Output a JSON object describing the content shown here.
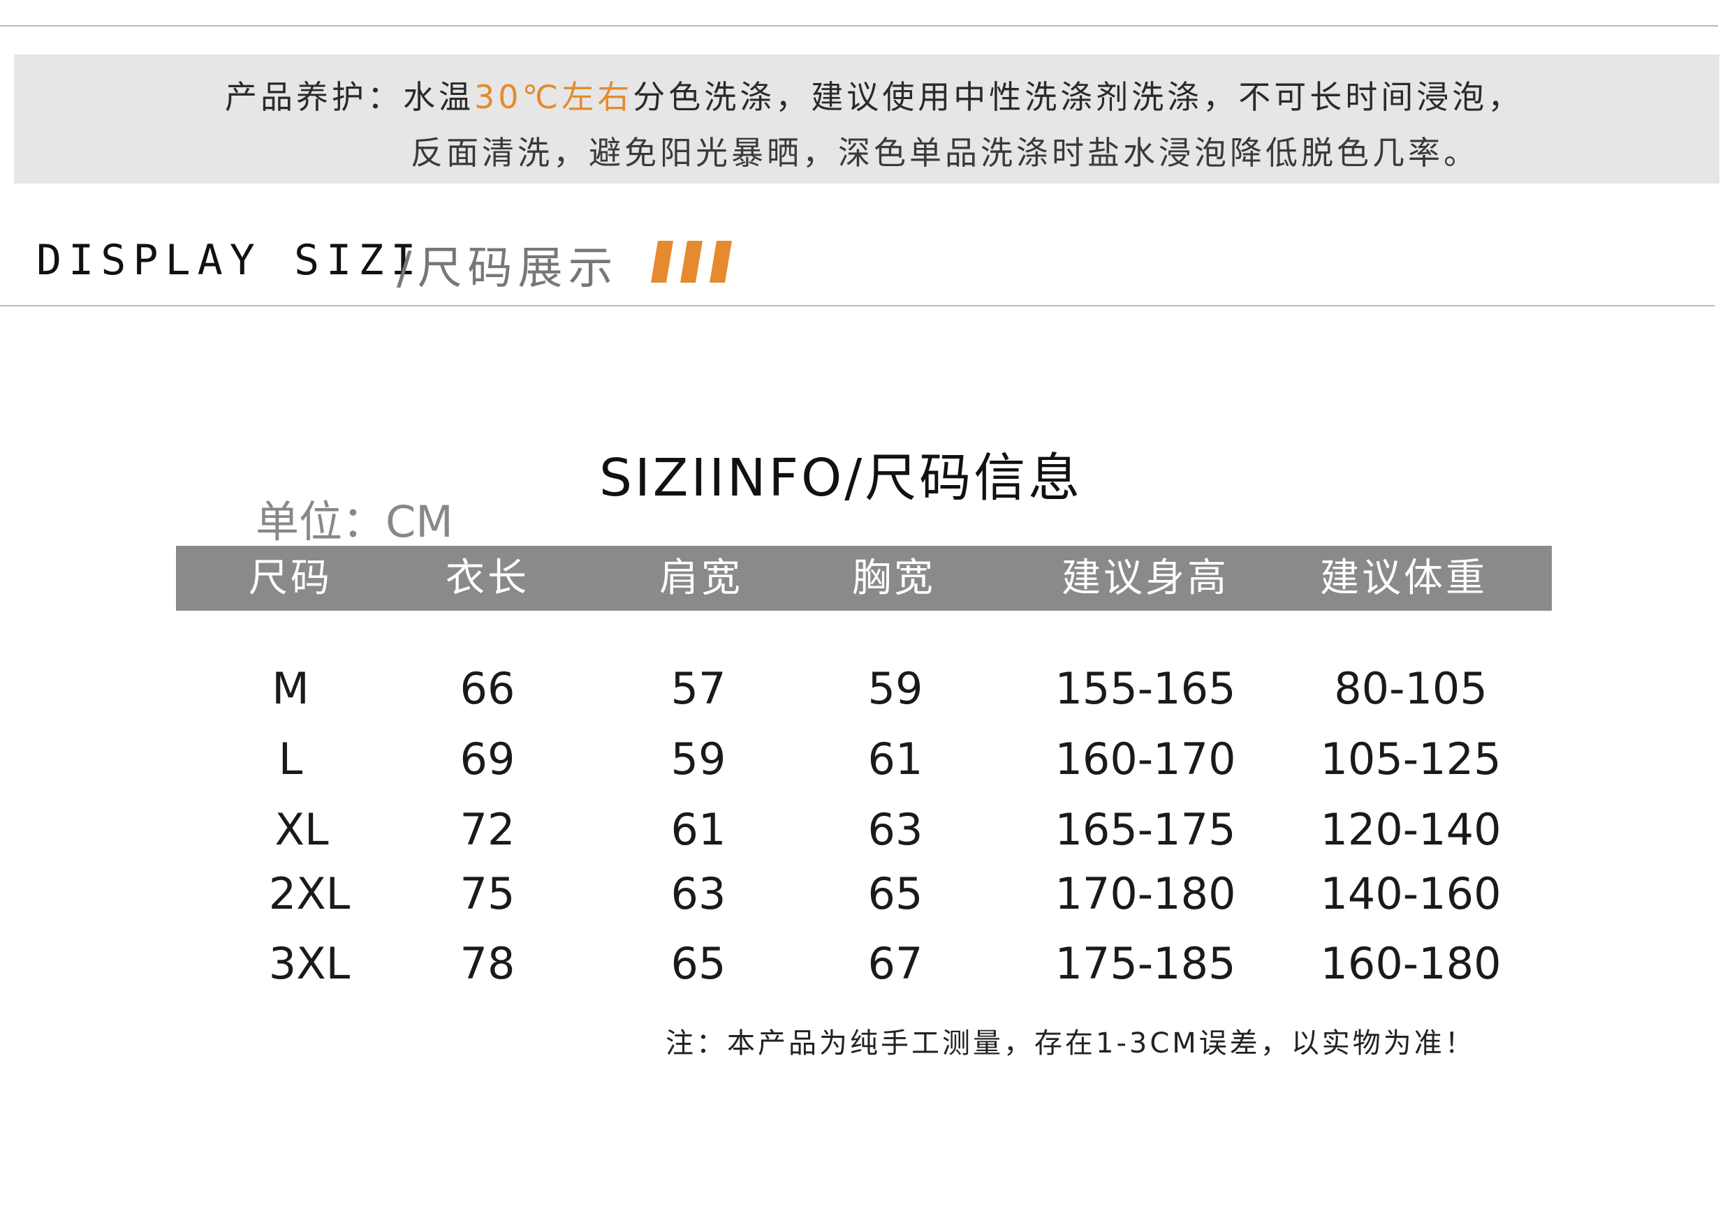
{
  "care": {
    "label": "产品养护：",
    "line1_before": "水温",
    "line1_accent": "30℃左右",
    "line1_after": "分色洗涤，建议使用中性洗涤剂洗涤，不可长时间浸泡，",
    "line2": "反面清洗，避免阳光暴晒，深色单品洗涤时盐水浸泡降低脱色几率。"
  },
  "display": {
    "title": "DISPLAY SIZI",
    "subtitle": "/尺码展示"
  },
  "info": {
    "title": "SIZIINFO/尺码信息",
    "unit": "单位：CM"
  },
  "table": {
    "headers": [
      "尺码",
      "衣长",
      "肩宽",
      "胸宽",
      "建议身高",
      "建议体重"
    ],
    "rows": [
      [
        "M",
        "66",
        "57",
        "59",
        "155-165",
        "80-105"
      ],
      [
        "L",
        "69",
        "59",
        "61",
        "160-170",
        "105-125"
      ],
      [
        "XL",
        "72",
        "61",
        "63",
        "165-175",
        "120-140"
      ],
      [
        "2XL",
        "75",
        "63",
        "65",
        "170-180",
        "140-160"
      ],
      [
        "3XL",
        "78",
        "65",
        "67",
        "175-185",
        "160-180"
      ]
    ]
  },
  "note": "注：本产品为纯手工测量，存在1-3CM误差，以实物为准！",
  "colors": {
    "accent": "#e58a2e",
    "header_bg": "#8a8a8a",
    "care_bg": "#e6e6e6"
  }
}
